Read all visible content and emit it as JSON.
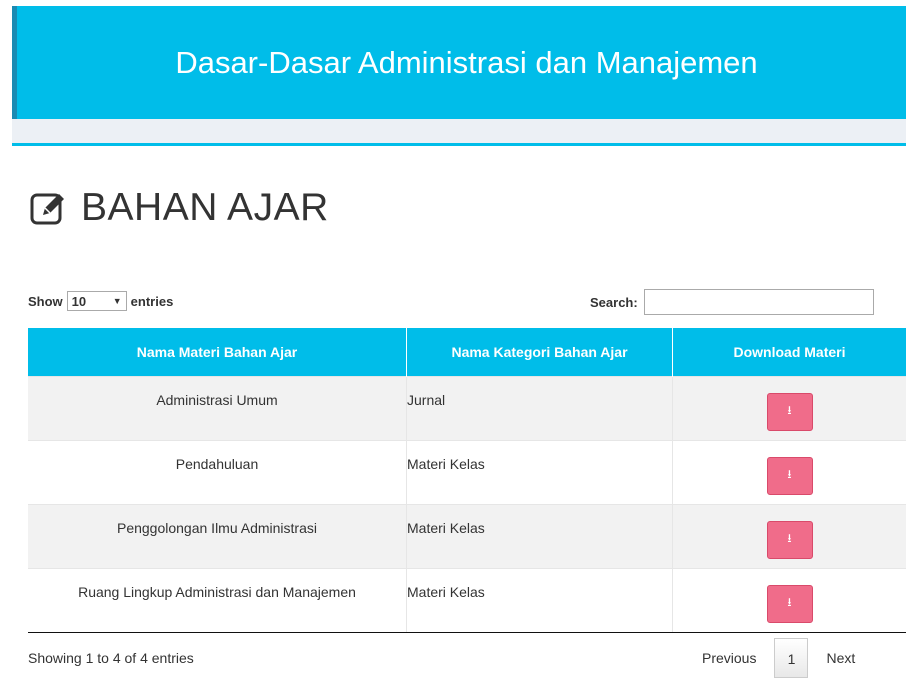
{
  "header": {
    "title": "Dasar-Dasar Administrasi dan Manajemen"
  },
  "page": {
    "title": "BAHAN AJAR",
    "title_icon": "edit-icon"
  },
  "length_control": {
    "show_label": "Show",
    "selected": "10",
    "entries_label": "entries"
  },
  "search": {
    "label": "Search:",
    "value": ""
  },
  "table": {
    "columns": [
      "Nama Materi Bahan Ajar",
      "Nama Kategori Bahan Ajar",
      "Download Materi"
    ],
    "rows": [
      {
        "name": "Administrasi Umum",
        "category": "Jurnal",
        "download_icon": "download-icon"
      },
      {
        "name": "Pendahuluan",
        "category": "Materi Kelas",
        "download_icon": "download-icon"
      },
      {
        "name": "Penggolongan Ilmu Administrasi",
        "category": "Materi Kelas",
        "download_icon": "download-icon"
      },
      {
        "name": "Ruang Lingkup Administrasi dan Manajemen",
        "category": "Materi Kelas",
        "download_icon": "download-icon"
      }
    ]
  },
  "info": "Showing 1 to 4 of 4 entries",
  "pagination": {
    "previous": "Previous",
    "current": "1",
    "next": "Next"
  },
  "colors": {
    "accent": "#00bde9",
    "download_button": "#f06c8a",
    "page_bg": "#ecf0f5"
  }
}
